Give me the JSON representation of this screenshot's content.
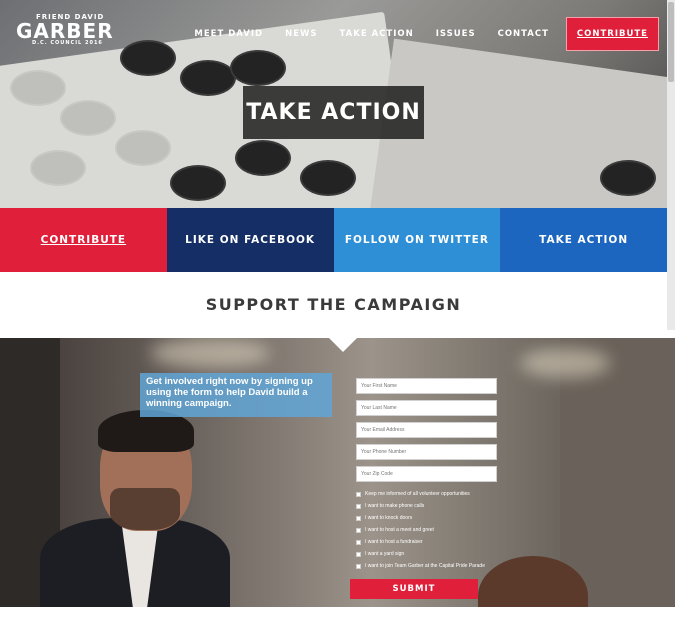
{
  "logo": {
    "line1": "FRIEND DAVID",
    "line2": "GARBER",
    "line3": "D.C. COUNCIL 2016"
  },
  "nav": {
    "items": [
      "MEET DAVID",
      "NEWS",
      "TAKE ACTION",
      "ISSUES",
      "CONTACT"
    ],
    "contribute": "CONTRIBUTE"
  },
  "hero": {
    "title": "TAKE ACTION"
  },
  "actions": {
    "contribute": "CONTRIBUTE",
    "facebook": "LIKE ON FACEBOOK",
    "twitter": "FOLLOW ON TWITTER",
    "take_action": "TAKE ACTION"
  },
  "support": {
    "title": "SUPPORT THE CAMPAIGN"
  },
  "signup": {
    "blurb": "Get involved right now by signing up using the form to help David build a winning campaign.",
    "fields": {
      "first_name": "Your First Name",
      "last_name": "Your Last Name",
      "email": "Your Email Address",
      "phone": "Your Phone Number",
      "zip": "Your Zip Code"
    },
    "checkboxes": [
      "Keep me informed of all volunteer opportunities",
      "I want to make phone calls",
      "I want to knock doors",
      "I want to host a meet and greet",
      "I want to host a fundraiser",
      "I want a yard sign",
      "I want to join Team Garber at the Capital Pride Parade"
    ],
    "submit": "SUBMIT"
  },
  "colors": {
    "red": "#e0203a",
    "navy": "#152f66",
    "sky": "#2e8fd6",
    "blue": "#1d66c0"
  }
}
